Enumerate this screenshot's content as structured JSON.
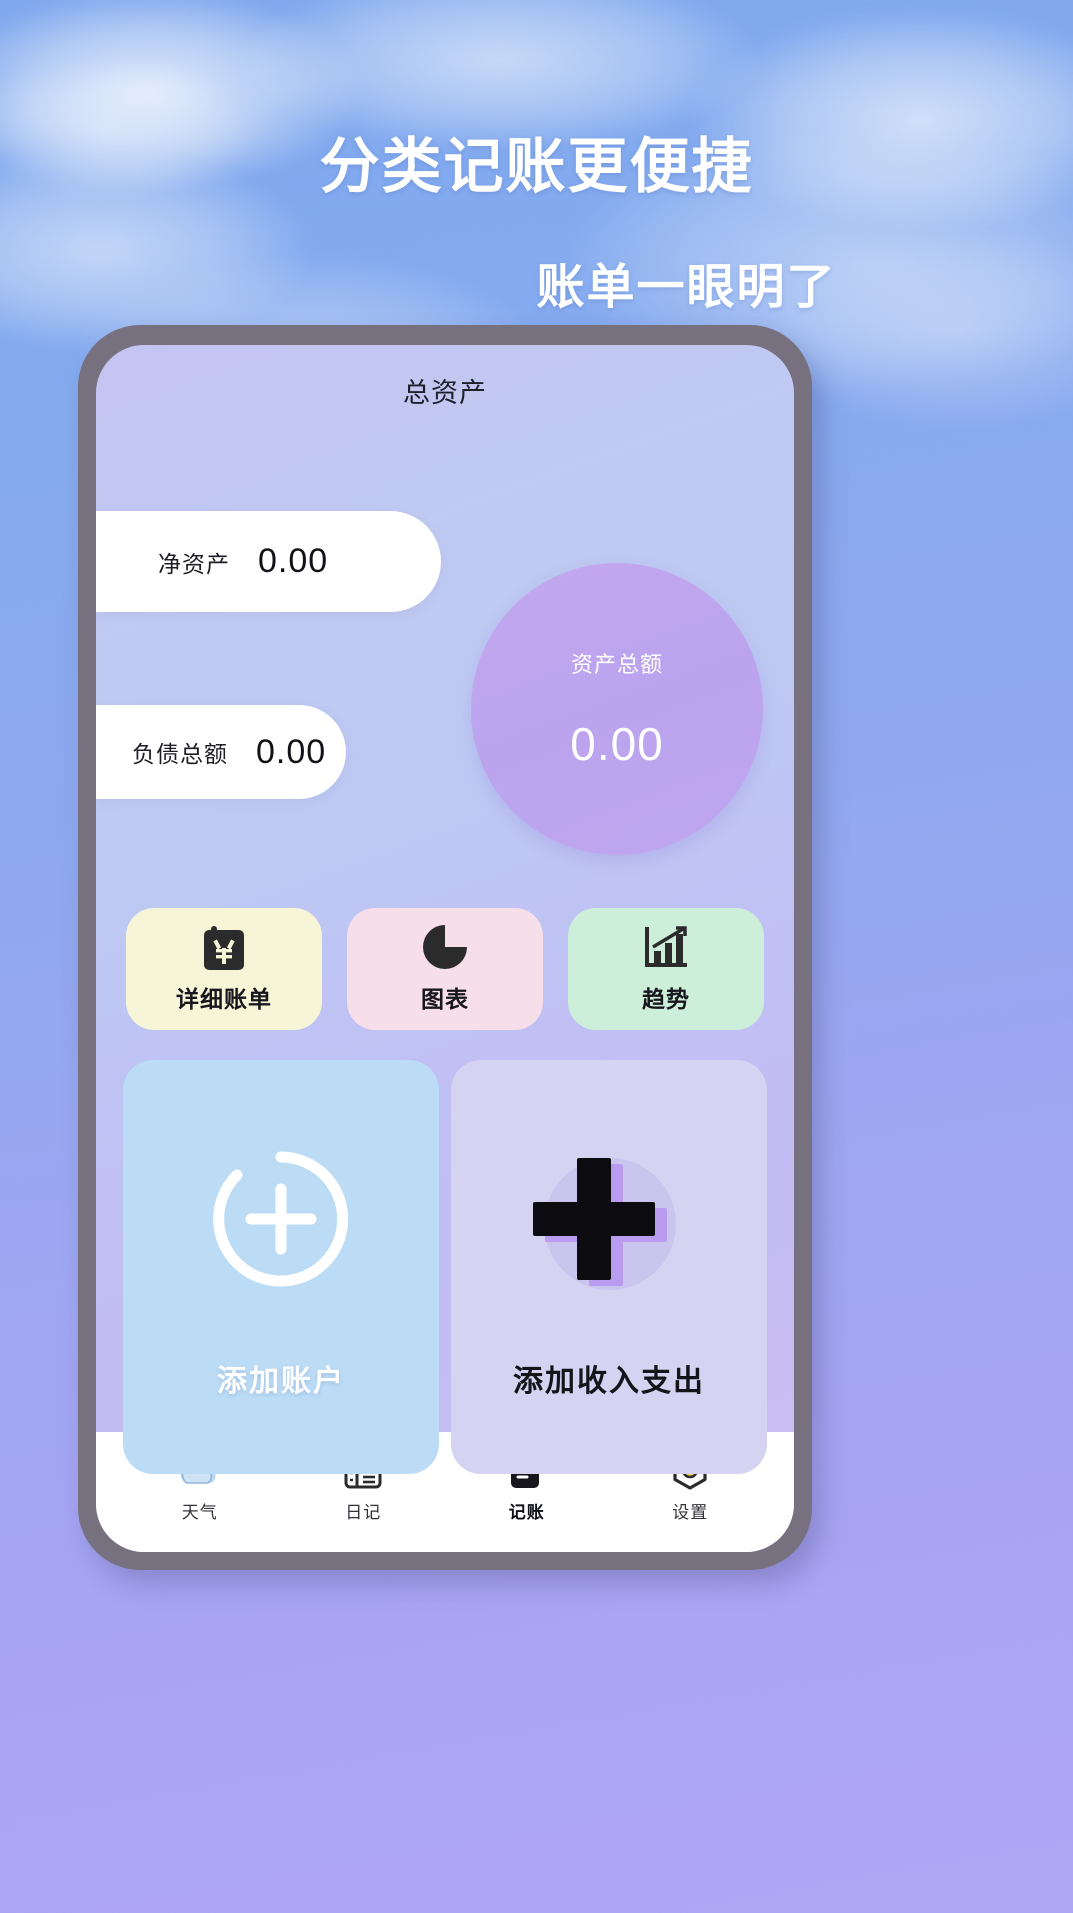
{
  "promo": {
    "headline_line1": "分类记账更便捷",
    "headline_line2": "账单一眼明了"
  },
  "app": {
    "screen_title": "总资产",
    "summary": {
      "net_assets_label": "净资产",
      "net_assets_value": "0.00",
      "total_liabilities_label": "负债总额",
      "total_liabilities_value": "0.00",
      "total_assets_label": "资产总额",
      "total_assets_value": "0.00"
    },
    "quick_actions": [
      {
        "label": "详细账单",
        "icon": "clipboard-yen-icon",
        "bg": "#f6f5d8"
      },
      {
        "label": "图表",
        "icon": "pie-chart-icon",
        "bg": "#f7dfe9"
      },
      {
        "label": "趋势",
        "icon": "bar-chart-trend-icon",
        "bg": "#cdeed9"
      }
    ],
    "big_actions": [
      {
        "label": "添加账户",
        "icon": "plus-circle-outline-icon",
        "bg": "#bcdcf6"
      },
      {
        "label": "添加收入支出",
        "icon": "plus-bold-icon",
        "bg": "#d5d2f2"
      }
    ],
    "nav": [
      {
        "label": "天气",
        "icon": "cloud-sun-icon",
        "active": false
      },
      {
        "label": "日记",
        "icon": "notebook-icon",
        "active": false
      },
      {
        "label": "记账",
        "icon": "ledger-icon",
        "active": true
      },
      {
        "label": "设置",
        "icon": "gear-hexagon-icon",
        "active": false
      }
    ]
  },
  "colors": {
    "sky": "#85aaef",
    "phone_frame": "#77707f",
    "circle_purple": "#bba3ee",
    "accent_yellow": "#f6f5d8",
    "accent_pink": "#f7dfe9",
    "accent_green": "#cdeed9",
    "card_blue": "#bcdcf6",
    "card_lavender": "#d5d2f2"
  }
}
